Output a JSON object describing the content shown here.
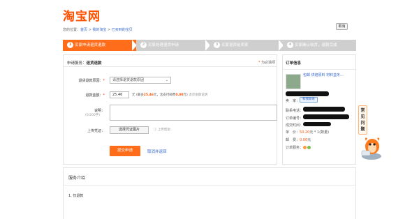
{
  "header": {
    "logo": "淘宝网",
    "close_label": "取消"
  },
  "breadcrumb": {
    "prefix": "您的位置：",
    "items": [
      "首页",
      "我的淘宝",
      "已买到的宝贝"
    ],
    "separator": " > "
  },
  "steps": [
    {
      "num": "1",
      "label": "买家申请退货退款"
    },
    {
      "num": "2",
      "label": "买家处理退货申请"
    },
    {
      "num": "3",
      "label": "买家退货给卖家"
    },
    {
      "num": "4",
      "label": "买家确认收货，退款完成"
    }
  ],
  "service": {
    "label": "申请服务：",
    "value": "退货退款",
    "help": "为必填项",
    "help_star": "*"
  },
  "form": {
    "reason_label": "退货退款原因：",
    "reason_placeholder": "请选择退货退款原因",
    "amount_label": "退款金额：",
    "amount_value": "25.46",
    "amount_unit": "元",
    "amount_note_a": "(最多",
    "amount_note_max": "25.46",
    "amount_note_b": "元，含支付邮费",
    "amount_note_ship": "0.00",
    "amount_note_c": "元)",
    "amount_note_d": "退货金额说明",
    "desc_label": "说明：",
    "desc_counter": "(0/200字)",
    "upload_label": "上传凭证：",
    "upload_button": "选择凭证图片",
    "upload_help": "上传帮助",
    "submit": "提交申请",
    "cancel": "取消并返回"
  },
  "order": {
    "title": "订单信息",
    "item_title": "包邮 烘焙原料 材料益冬...",
    "seller_label": "卖　家：",
    "contact": "和我联系",
    "order_no_label": "联系电话：",
    "time_label": "订单编号：",
    "trade_label": "成交时间：",
    "price_label": "单　价：",
    "price_value": "50.20",
    "price_suffix": "元 * 1(数量)",
    "ship_label": "邮　费：",
    "ship_value": "0.00",
    "ship_suffix": "元",
    "service_label": "订单服务："
  },
  "service_intro": {
    "title": "服务介绍",
    "item1": "1. 仅退款"
  },
  "faq": {
    "label": "常见问题"
  },
  "colors": {
    "accent": "#ff6c1a",
    "brand": "#ff5000",
    "link": "#3366cc"
  }
}
